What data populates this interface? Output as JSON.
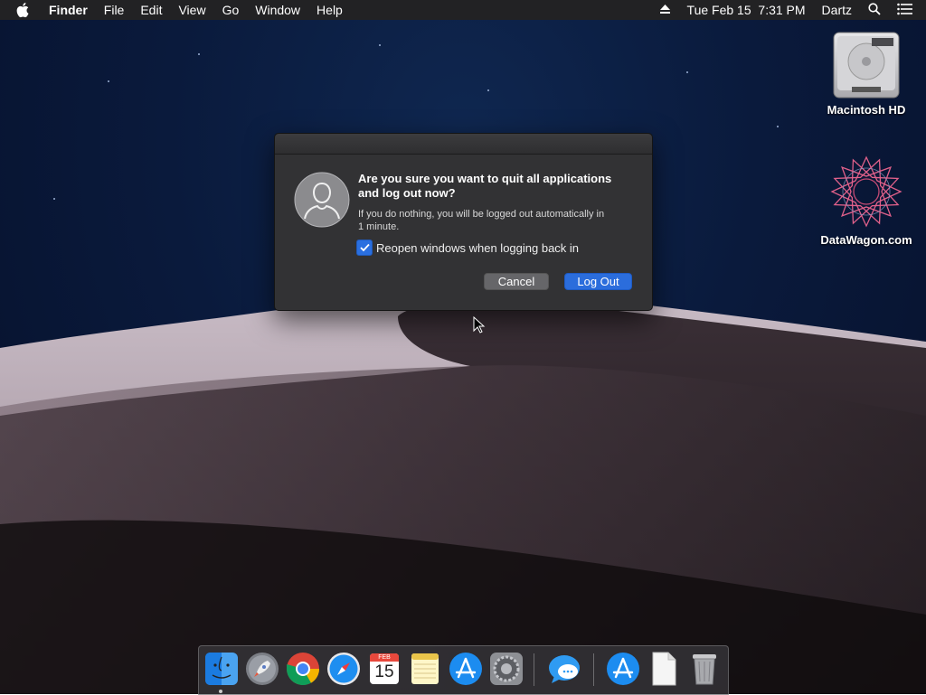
{
  "menubar": {
    "app_name": "Finder",
    "menus": [
      "File",
      "Edit",
      "View",
      "Go",
      "Window",
      "Help"
    ],
    "datetime": "Tue Feb 15  7:31 PM",
    "user": "Dartz"
  },
  "desktop_icons": [
    {
      "label": "Macintosh HD",
      "icon": "hard-drive-icon"
    },
    {
      "label": "DataWagon.com",
      "icon": "geometric-star-icon"
    }
  ],
  "dialog": {
    "title_line1": "Are you sure you want to quit all applications",
    "title_line2": "and log out now?",
    "message_line1": "If you do nothing, you will be logged out automatically in",
    "message_line2": "1 minute.",
    "checkbox_label": "Reopen windows when logging back in",
    "checkbox_checked": true,
    "cancel_label": "Cancel",
    "logout_label": "Log Out",
    "accent_color": "#2b6ddc"
  },
  "dock": {
    "calendar_month": "FEB",
    "calendar_day": "15",
    "items": [
      "finder-icon",
      "launchpad-icon",
      "chrome-icon",
      "safari-icon",
      "calendar-icon",
      "notes-icon",
      "app-store-icon",
      "system-preferences-icon",
      "messages-icon",
      "app-store-folder-icon",
      "document-icon",
      "trash-icon"
    ]
  }
}
